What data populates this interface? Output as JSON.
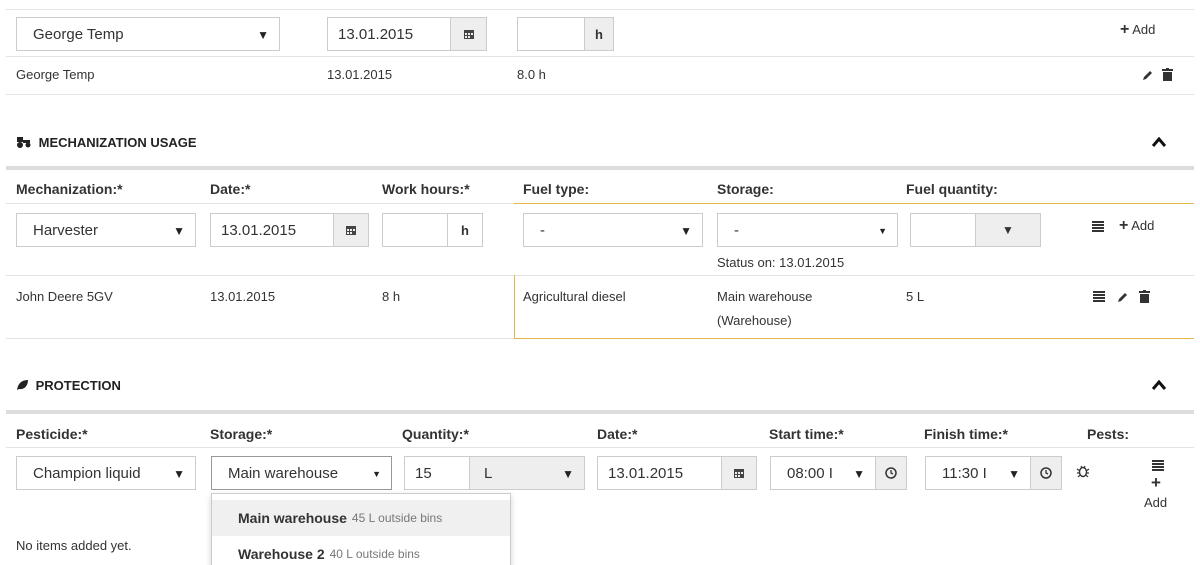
{
  "worker_row": {
    "worker_select": "George Temp",
    "date_value": "13.01.2015",
    "hours_value": "",
    "hours_unit": "h",
    "add_label": "Add"
  },
  "worker_entry": {
    "name": "George Temp",
    "date": "13.01.2015",
    "hours": "8.0 h"
  },
  "mechanization": {
    "title": "MECHANIZATION USAGE",
    "headers": [
      "Mechanization:*",
      "Date:*",
      "Work hours:*",
      "Fuel type:",
      "Storage:",
      "Fuel quantity:"
    ],
    "form": {
      "mechanization_select": "Harvester",
      "date_value": "13.01.2015",
      "hours_value": "",
      "hours_unit": "h",
      "fuel_type_select": "-",
      "storage_select": "-",
      "status_text": "Status on: 13.01.2015",
      "fuel_qty_value": "",
      "add_label": "Add"
    },
    "entry": {
      "mechanization": "John Deere 5GV",
      "date": "13.01.2015",
      "hours": "8 h",
      "fuel_type": "Agricultural diesel",
      "storage_line1": "Main warehouse",
      "storage_line2": "(Warehouse)",
      "fuel_qty": "5 L"
    }
  },
  "protection": {
    "title": "PROTECTION",
    "headers": [
      "Pesticide:*",
      "Storage:*",
      "Quantity:*",
      "Date:*",
      "Start time:*",
      "Finish time:*",
      "Pests:"
    ],
    "form": {
      "pesticide_select": "Champion liquid",
      "storage_select": "Main warehouse",
      "quantity_value": "15",
      "unit_select": "L",
      "date_value": "13.01.2015",
      "start_time": "08:00 I",
      "finish_time": "11:30 I",
      "add_label": "Add"
    },
    "storage_options": [
      {
        "name": "Main warehouse",
        "detail": "45 L outside bins"
      },
      {
        "name": "Warehouse 2",
        "detail": "40 L outside bins"
      }
    ],
    "empty_text": "No items added yet."
  },
  "colors": {
    "accent_line": "#e5b84c",
    "section_rule": "#dddddd"
  },
  "icons": [
    "calendar-icon",
    "plus-icon",
    "pencil-icon",
    "trash-icon",
    "tractor-icon",
    "leaf-icon",
    "chevron-up-icon",
    "list-icon",
    "clock-icon",
    "bug-icon"
  ]
}
